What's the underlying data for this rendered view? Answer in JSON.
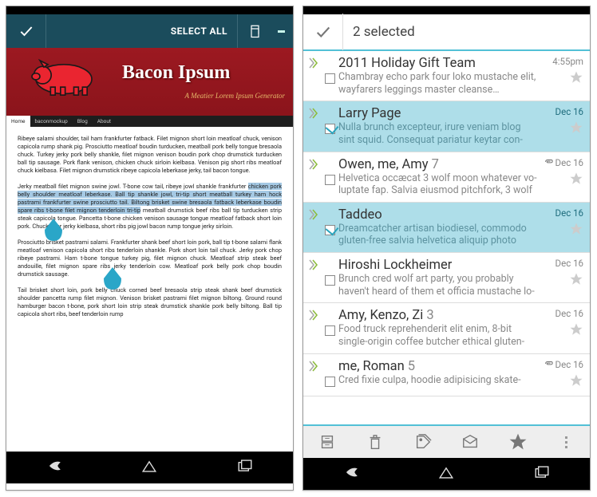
{
  "left": {
    "actionbar": {
      "select_all": "SELECT ALL"
    },
    "banner": {
      "title": "Bacon Ipsum",
      "subtitle": "A Meatier Lorem Ipsum Generator"
    },
    "nav": {
      "home": "Home",
      "items": [
        "baconmockup",
        "Blog",
        "About"
      ]
    },
    "paragraphs": [
      "Ribeye salami shoulder, tail ham frankfurter fatback. Filet mignon short loin meatloaf chuck, venison capicola rump shank pig. Prosciutto meatloaf boudin turducken, meatball pork belly tongue bresaola chuck. Turkey jerky pork belly shankle, filet mignon venison boudin pork chop drumstick turducken ball tip sausage. Pork flank venison, chicken chuck sirloin kielbasa. Venison pig short ribs meatloaf chuck kielbasa. Filet mignon drumstick ribeye capicola leberkase jerky, tail bacon tongue.",
      "Meatball filet mignon swine jowl. T-bone cow tail, ribeye jowl shankle frankfurter chicken pork belly shoulder meatloaf leberkase. Ball tip shankle jowl, tri-tip short meatball turkey ham hock pastrami frankfurter swine prosciutto tail. Biltong brisket swine bresaola fatback leberkase boudin spare ribs t-bone filet mignon tenderloin tri-tip meatball drumstick beef ribs ball tip turducken strip steak capicola tongue. Pancetta t-bone chicken venison sausage tongue meatloaf fatback short loin pork. Chuck beer jerky kielbasa, short ribs pig jowl bacon rump tongue jerky sirloin.",
      "Prosciutto brisket pastrami salami. Frankfurter shank beef short loin pork, ball tip t-bone salami flank meatloaf venison capicola short ribs tenderloin shankle. Pork short loin tail chuck. Jerky pork chop ribeye pastrami. Ham t-bone tongue turkey pig, filet mignon chuck. Meatloaf strip steak beef andouille, filet mignon spare ribs jerky tenderloin cow. Meatloaf pork belly pork chop boudin drumstick sausage.",
      "Tail brisket short loin, pork belly chuck corned beef bresaola strip steak shank beef drumstick shoulder pancetta rump filet mignon. Venison brisket pastrami filet mignon biltong. Ground round hamburger bacon t-bone, pork short loin strip steak drumstick shankle pork belly biltong. Ball tip capicola short ribs, beef tenderloin rump"
    ],
    "highlight": "chicken pork belly shoulder meatloaf leberkase. Ball tip shankle jowl, tri-tip short meatball turkey ham hock pastrami frankfurter swine prosciutto tail. Biltong brisket swine bresaola fatback leberkase boudin spare ribs t-bone filet mignon tenderloin tri-tip"
  },
  "right": {
    "header": {
      "count_text": "2 selected"
    },
    "rows": [
      {
        "sender": "2011 Holiday Gift Team",
        "count": "",
        "snippet": "Chambray echo park four loko mustache elit, wayfarers leggings master cleanse incididunt",
        "time": "4:55pm",
        "selected": false,
        "clip": false
      },
      {
        "sender": "Larry Page",
        "count": "",
        "snippet": "Nulla brunch excepteur, irure veniam blog sint squid. Consequat pariatur keytar con-",
        "time": "Dec 16",
        "selected": true,
        "clip": false
      },
      {
        "sender": "Owen, me, Amy",
        "count": "7",
        "snippet": "Helvetica occæcat 3 wolf moon whatever vo-luptate fap. Salvia eiusmod pitchfork, 3 wolf",
        "time": "Dec 16",
        "selected": false,
        "clip": true
      },
      {
        "sender": "Taddeo",
        "count": "",
        "snippet": "Dreamcatcher artisan biodiesel, commodo gluten-free salvia helvetica aliquip photo",
        "time": "Dec 16",
        "selected": true,
        "clip": false
      },
      {
        "sender": "Hiroshi Lockheimer",
        "count": "",
        "snippet": "Brunch cred wolf art party, you probably haven't heard of them et officia mustache lo-",
        "time": "Dec 16",
        "selected": false,
        "clip": false
      },
      {
        "sender": "Amy, Kenzo, Zi",
        "count": "3",
        "snippet": "Food truck reprehenderit elit enim, 8-bit single-origin coffee butcher ethical gluten-",
        "time": "Dec 16",
        "selected": false,
        "clip": false
      },
      {
        "sender": "me, Roman",
        "count": "5",
        "snippet": "Cred fixie culpa, hoodie adipisicing skate-",
        "time": "Dec 16",
        "selected": false,
        "clip": true
      }
    ]
  }
}
